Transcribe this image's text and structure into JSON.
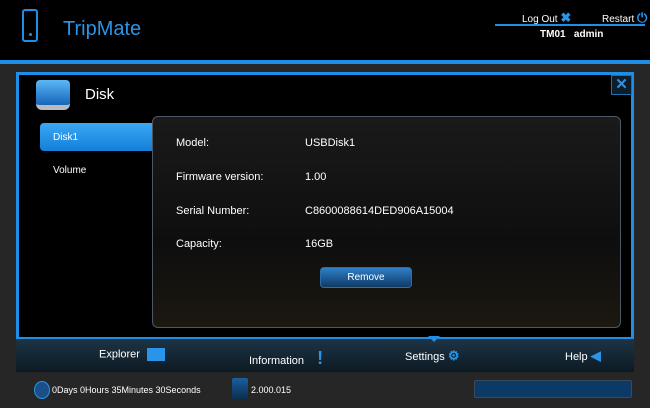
{
  "header": {
    "brand": "TripMate",
    "logout": "Log Out",
    "restart": "Restart",
    "device": "TM01",
    "user": "admin"
  },
  "dialog": {
    "title": "Disk",
    "close": "✕",
    "tabs": [
      {
        "label": "Disk1",
        "selected": true
      },
      {
        "label": "Volume",
        "selected": false
      }
    ],
    "fields": [
      {
        "label": "Model:",
        "value": "USBDisk1"
      },
      {
        "label": "Firmware version:",
        "value": "1.00"
      },
      {
        "label": "Serial Number:",
        "value": "C8600088614DED906A15004"
      },
      {
        "label": "Capacity:",
        "value": "16GB"
      }
    ],
    "remove_label": "Remove"
  },
  "nav": [
    {
      "label": "Explorer",
      "icon": "folder-icon"
    },
    {
      "label": "Information",
      "icon": "exclamation-icon"
    },
    {
      "label": "Settings",
      "icon": "gear-icon",
      "active": true
    },
    {
      "label": "Help",
      "icon": "arrow-left-icon"
    }
  ],
  "status": {
    "uptime": "0Days 0Hours 35Minutes 30Seconds",
    "version": "2.000.015"
  },
  "colors": {
    "accent": "#1e8ee6"
  }
}
